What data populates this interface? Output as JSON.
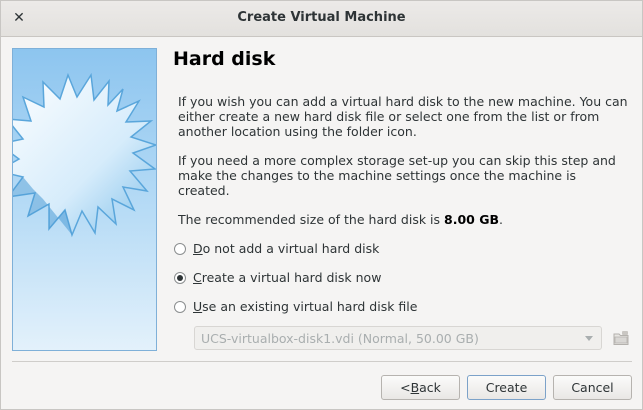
{
  "window": {
    "title": "Create Virtual Machine",
    "close_glyph": "✕"
  },
  "page": {
    "heading": "Hard disk",
    "paragraph1": "If you wish you can add a virtual hard disk to the new machine. You can either create a new hard disk file or select one from the list or from another location using the folder icon.",
    "paragraph2": "If you need a more complex storage set-up you can skip this step and make the changes to the machine settings once the machine is created.",
    "recommend_prefix": "The recommended size of the hard disk is ",
    "recommend_value": "8.00 GB",
    "recommend_suffix": "."
  },
  "options": [
    {
      "mnemonic": "D",
      "rest": "o not add a virtual hard disk",
      "checked": false
    },
    {
      "mnemonic": "C",
      "rest": "reate a virtual hard disk now",
      "checked": true
    },
    {
      "mnemonic": "U",
      "rest": "se an existing virtual hard disk file",
      "checked": false
    }
  ],
  "disk_select": {
    "value": "UCS-virtualbox-disk1.vdi (Normal, 50.00 GB)",
    "enabled": false
  },
  "buttons": {
    "back_lt": "< ",
    "back_mnemonic": "B",
    "back_rest": "ack",
    "create": "Create",
    "cancel": "Cancel"
  },
  "colors": {
    "accent": "#7ca2c9",
    "side_image_top": "#8dc5ef",
    "side_image_bottom": "#e3f1fb"
  }
}
